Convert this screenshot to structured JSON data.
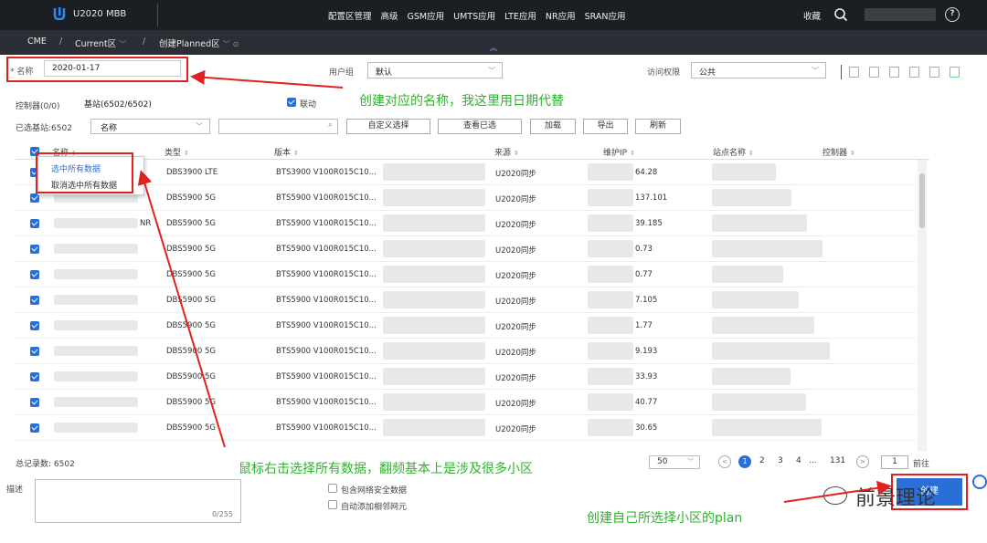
{
  "topnav": {
    "app_title": "U2020 MBB",
    "menu": [
      "配置区管理",
      "高级",
      "GSM应用",
      "UMTS应用",
      "LTE应用",
      "NR应用",
      "SRAN应用"
    ],
    "favorites": "收藏"
  },
  "breadcrumb": {
    "items": [
      "CME",
      "Current区",
      "创建Planned区"
    ],
    "sep": "/"
  },
  "form": {
    "name_label": "名称",
    "name_value": "2020-01-17",
    "usergroup_label": "用户组",
    "usergroup_value": "默认",
    "access_label": "访问权限",
    "access_value": "公共"
  },
  "tabs": {
    "controller": "控制器(0/0)",
    "basestation": "基站(6502/6502)",
    "linked": "联动"
  },
  "toolbar": {
    "selected": "已选基站:6502",
    "filter_field": "名称",
    "custom_select": "自定义选择",
    "view_selected": "查看已选",
    "load": "加载",
    "export": "导出",
    "refresh": "刷新"
  },
  "table": {
    "headers": [
      "名称",
      "类型",
      "版本",
      "来源",
      "维护IP",
      "站点名称",
      "控制器"
    ],
    "rows": [
      {
        "name": "",
        "type": "DBS3900 LTE",
        "version": "BTS3900 V100R015C10...",
        "source": "U2020同步",
        "ip": "64.28"
      },
      {
        "name": "",
        "type": "DBS5900 5G",
        "version": "BTS5900 V100R015C10...",
        "source": "U2020同步",
        "ip": "137.101"
      },
      {
        "name": "NR",
        "type": "DBS5900 5G",
        "version": "BTS5900 V100R015C10...",
        "source": "U2020同步",
        "ip": "39.185"
      },
      {
        "name": "",
        "type": "DBS5900 5G",
        "version": "BTS5900 V100R015C10...",
        "source": "U2020同步",
        "ip": "0.73"
      },
      {
        "name": "",
        "type": "DBS5900 5G",
        "version": "BTS5900 V100R015C10...",
        "source": "U2020同步",
        "ip": "0.77"
      },
      {
        "name": "",
        "type": "DBS5900 5G",
        "version": "BTS5900 V100R015C10...",
        "source": "U2020同步",
        "ip": "7.105"
      },
      {
        "name": "",
        "type": "DBS5900 5G",
        "version": "BTS5900 V100R015C10...",
        "source": "U2020同步",
        "ip": "1.77"
      },
      {
        "name": "",
        "type": "DBS5900 5G",
        "version": "BTS5900 V100R015C10...",
        "source": "U2020同步",
        "ip": "9.193"
      },
      {
        "name": "",
        "type": "DBS5900 5G",
        "version": "BTS5900 V100R015C10...",
        "source": "U2020同步",
        "ip": "33.93"
      },
      {
        "name": "",
        "type": "DBS5900 5G",
        "version": "BTS5900 V100R015C10...",
        "source": "U2020同步",
        "ip": "40.77"
      },
      {
        "name": "",
        "type": "DBS5900 5G",
        "version": "BTS5900 V100R015C10...",
        "source": "U2020同步",
        "ip": "30.65"
      }
    ]
  },
  "context_menu": {
    "select_all": "选中所有数据",
    "deselect_all": "取消选中所有数据"
  },
  "annotations": {
    "name_note": "创建对应的名称，我这里用日期代替",
    "select_note": "鼠标右击选择所有数据，翻频基本上是涉及很多小区",
    "plan_note": "创建自己所选择小区的plan"
  },
  "footer": {
    "total": "总记录数: 6502",
    "page_size": "50",
    "pages": [
      "1",
      "2",
      "3",
      "4",
      "...",
      "131"
    ],
    "goto_value": "1",
    "goto_label": "前往"
  },
  "bottom": {
    "desc_label": "描述",
    "desc_count": "0/255",
    "opt_security": "包含网络安全数据",
    "opt_neighbor": "自动添加相邻网元",
    "create_label": "创建"
  },
  "watermark": "前景理论",
  "colors": {
    "accent": "#2a6fd6",
    "annotation": "#2cb52c",
    "highlight": "#e32020"
  }
}
